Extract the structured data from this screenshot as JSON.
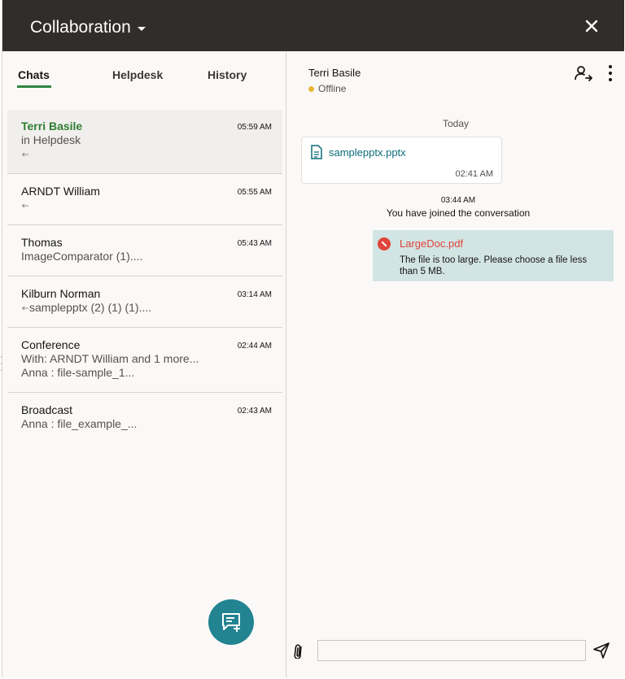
{
  "header": {
    "title": "Collaboration",
    "close_label": "close",
    "background": "#312d2a"
  },
  "tabs": [
    {
      "label": "Chats",
      "active": true
    },
    {
      "label": "Helpdesk",
      "active": false
    },
    {
      "label": "History",
      "active": false
    }
  ],
  "chats": [
    {
      "name": "Terri Basile",
      "time": "05:59 AM",
      "line1": "in Helpdesk",
      "line2": "",
      "line2_reply_icon": true,
      "selected": true
    },
    {
      "name": "ARNDT William",
      "time": "05:55 AM",
      "line1": "",
      "line1_reply_icon": true
    },
    {
      "name": "Thomas",
      "time": "05:43 AM",
      "line1": "ImageComparator (1)...."
    },
    {
      "name": "Kilburn Norman",
      "time": "03:14 AM",
      "line1": "samplepptx (2) (1) (1)....",
      "line1_reply_icon": true
    },
    {
      "name": "Conference",
      "time": "02:44 AM",
      "line1": "With: ARNDT William and 1 more...",
      "line2": "Anna : file-sample_1..."
    },
    {
      "name": "Broadcast",
      "time": "02:43 AM",
      "line1": "Anna : file_example_..."
    }
  ],
  "conversation": {
    "contact_name": "Terri Basile",
    "status": "Offline",
    "status_color": "#e9b636",
    "day_label": "Today",
    "file_message": {
      "file_name": "samplepptx.pptx",
      "time": "02:41 AM"
    },
    "system_event": {
      "time": "03:44 AM",
      "text": "You have joined the conversation"
    },
    "error_message": {
      "file_name": "LargeDoc.pdf",
      "text": "The file is too large. Please choose a file less than 5 MB."
    }
  },
  "composer": {
    "placeholder": "",
    "value": ""
  },
  "colors": {
    "accent": "#228391",
    "active_tab": "#2e8540",
    "error": "#e0443a",
    "link": "#0e6b7a"
  }
}
